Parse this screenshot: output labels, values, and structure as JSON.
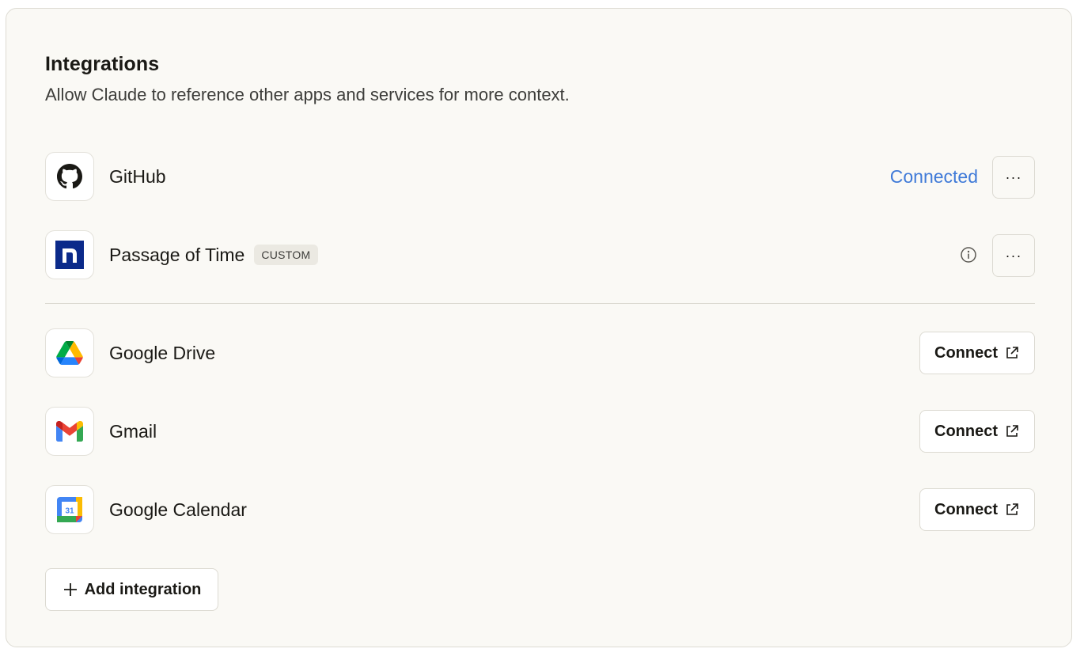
{
  "header": {
    "title": "Integrations",
    "subtitle": "Allow Claude to reference other apps and services for more context."
  },
  "connected_integrations": [
    {
      "name": "GitHub",
      "icon": "github-icon",
      "status": "Connected",
      "more_label": "···"
    },
    {
      "name": "Passage of Time",
      "icon": "passage-of-time-icon",
      "badge": "CUSTOM",
      "info_icon": "info-icon",
      "more_label": "···"
    }
  ],
  "available_integrations": [
    {
      "name": "Google Drive",
      "icon": "google-drive-icon",
      "action_label": "Connect"
    },
    {
      "name": "Gmail",
      "icon": "gmail-icon",
      "action_label": "Connect"
    },
    {
      "name": "Google Calendar",
      "icon": "google-calendar-icon",
      "action_label": "Connect",
      "calendar_day": "31"
    }
  ],
  "add_button": {
    "label": "Add integration"
  },
  "colors": {
    "connected": "#3f7ad8",
    "background": "#faf9f5",
    "text": "#1a1915",
    "passage_logo_bg": "#0b2a8a"
  }
}
